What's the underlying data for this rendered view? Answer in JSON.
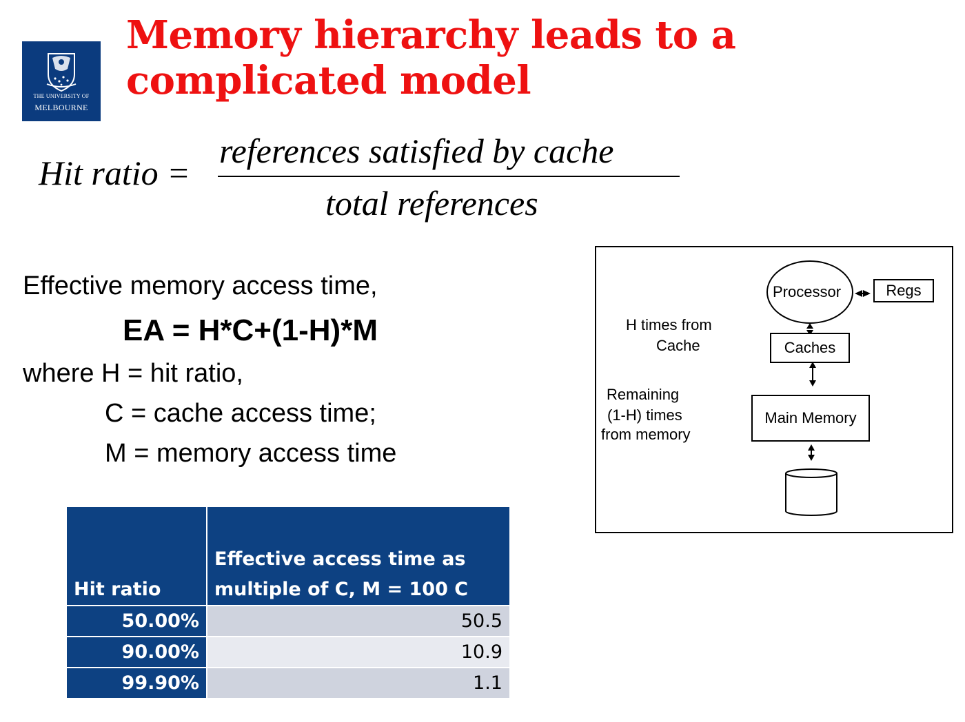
{
  "logo": {
    "line1": "THE UNIVERSITY OF",
    "line2": "MELBOURNE"
  },
  "title": {
    "line1": "Memory hierarchy leads to a",
    "line2": "complicated model"
  },
  "formula": {
    "lhs": "Hit ratio =",
    "numerator": "references satisfied by cache",
    "denominator": "total references"
  },
  "effective_access": {
    "intro": "Effective  memory access time,",
    "equation": "EA = H*C+(1-H)*M",
    "where": "where H = hit ratio,",
    "c_def": "C = cache access time;",
    "m_def": "M = memory access time"
  },
  "table": {
    "headers": [
      "Hit ratio",
      "Effective access time as multiple of C, M = 100 C"
    ],
    "header2_lines": [
      "Effective access time as",
      "multiple of C, M = 100 C"
    ],
    "rows": [
      {
        "hit_ratio": "50.00%",
        "effective": "50.5"
      },
      {
        "hit_ratio": "90.00%",
        "effective": "10.9"
      },
      {
        "hit_ratio": "99.90%",
        "effective": "1.1"
      }
    ]
  },
  "diagram": {
    "processor": "Processor",
    "regs": "Regs",
    "caches": "Caches",
    "main_memory": "Main Memory",
    "h_times": [
      "H times from",
      "Cache"
    ],
    "remaining": [
      "Remaining",
      "(1-H) times",
      "from memory"
    ]
  },
  "colors": {
    "title": "#ee1111",
    "logo_bg": "#0b3b7e",
    "table_header": "#0d4182",
    "table_row_light": "#e8eaf0",
    "table_row_dark": "#cfd3de"
  }
}
